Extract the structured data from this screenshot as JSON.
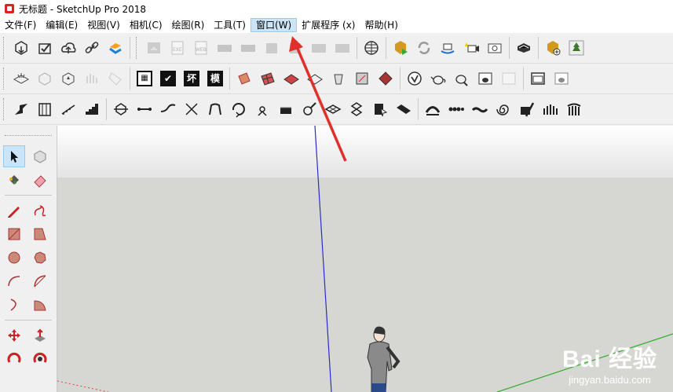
{
  "window": {
    "title": "无标题 - SketchUp Pro 2018"
  },
  "menu": {
    "items": [
      {
        "label": "文件(F)",
        "active": false
      },
      {
        "label": "编辑(E)",
        "active": false
      },
      {
        "label": "视图(V)",
        "active": false
      },
      {
        "label": "相机(C)",
        "active": false
      },
      {
        "label": "绘图(R)",
        "active": false
      },
      {
        "label": "工具(T)",
        "active": false
      },
      {
        "label": "窗口(W)",
        "active": true
      },
      {
        "label": "扩展程序 (x)",
        "active": false
      },
      {
        "label": "帮助(H)",
        "active": false
      }
    ]
  },
  "toolbar2": {
    "labels": [
      "坏",
      "模"
    ]
  },
  "watermark": {
    "brand": "Bai 经验",
    "url": "jingyan.baidu.com"
  },
  "colors": {
    "accent_arrow": "#e0302c",
    "menu_highlight": "#cce4f7",
    "ground": "#d6d6d2",
    "blue_axis": "#2a2ad0",
    "green_axis": "#2fae2f"
  }
}
